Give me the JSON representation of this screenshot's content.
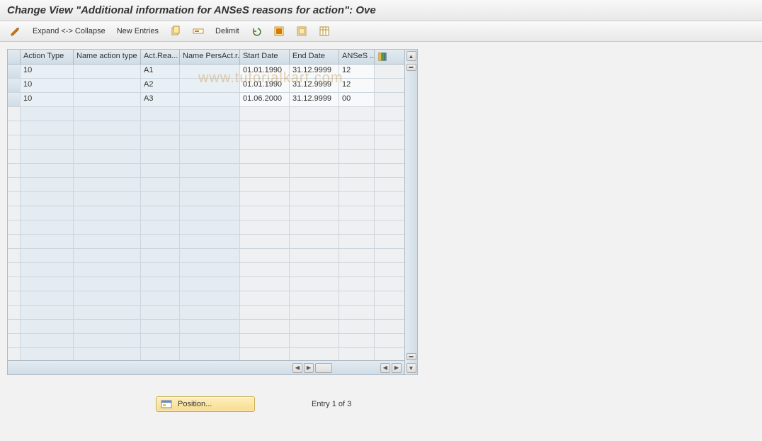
{
  "title": "Change View \"Additional information for ANSeS reasons for action\": Ove",
  "watermark": "www.tutorialkart.com",
  "toolbar": {
    "expand_collapse": "Expand <-> Collapse",
    "new_entries": "New Entries",
    "delimit": "Delimit"
  },
  "table": {
    "headers": {
      "action_type": "Action Type",
      "name_action_type": "Name action type",
      "act_rea": "Act.Rea...",
      "name_persact_r": "Name PersAct.r...",
      "start_date": "Start Date",
      "end_date": "End Date",
      "anses": "ANSeS .."
    },
    "rows": [
      {
        "action_type": "10",
        "name_action_type": "",
        "act_rea": "A1",
        "name_persact_r": "",
        "start_date": "01.01.1990",
        "end_date": "31.12.9999",
        "anses": "12"
      },
      {
        "action_type": "10",
        "name_action_type": "",
        "act_rea": "A2",
        "name_persact_r": "",
        "start_date": "01.01.1990",
        "end_date": "31.12.9999",
        "anses": "12"
      },
      {
        "action_type": "10",
        "name_action_type": "",
        "act_rea": "A3",
        "name_persact_r": "",
        "start_date": "01.06.2000",
        "end_date": "31.12.9999",
        "anses": "00"
      }
    ],
    "empty_rows": 18
  },
  "footer": {
    "position_label": "Position...",
    "entry_text": "Entry 1 of 3"
  }
}
